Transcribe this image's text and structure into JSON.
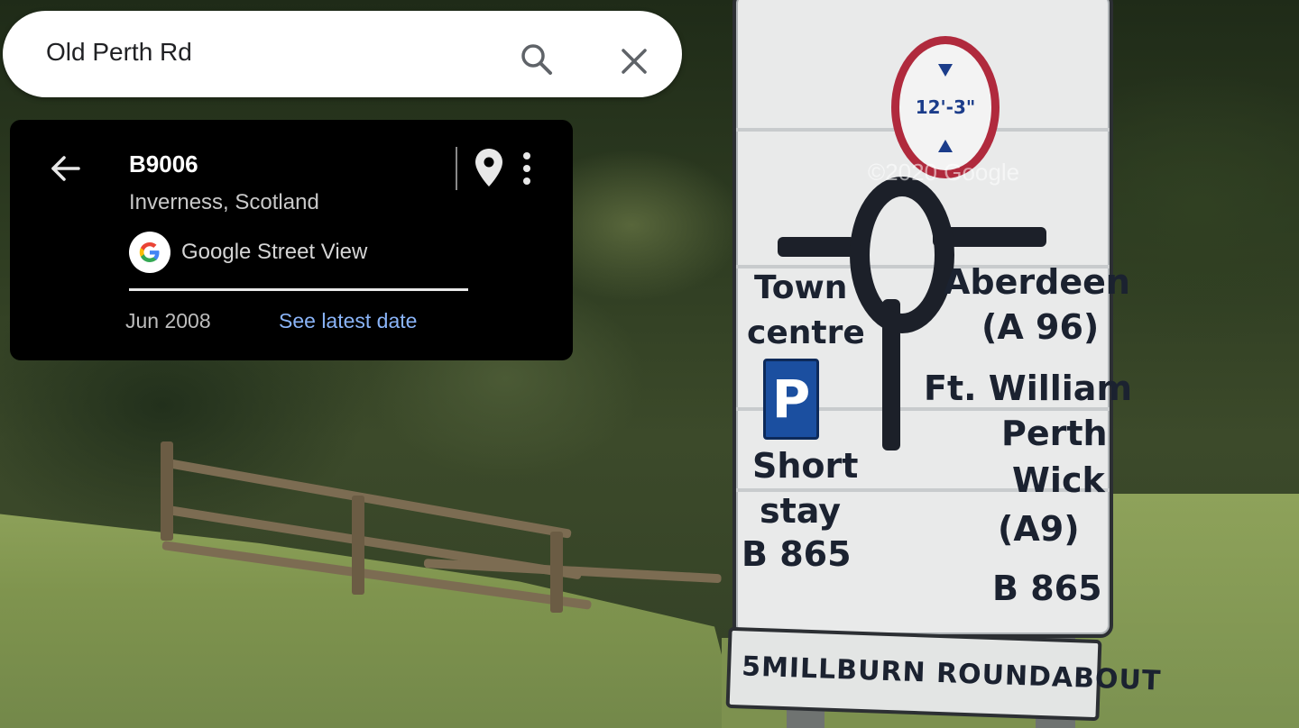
{
  "search": {
    "query": "Old Perth Rd"
  },
  "place_card": {
    "title": "B9006",
    "subtitle": "Inverness, Scotland",
    "source": "Google Street View",
    "capture_date": "Jun 2008",
    "latest_link": "See latest date"
  },
  "streetview": {
    "watermark": "©2020 Google",
    "sign": {
      "height_limit": "12'-3\"",
      "left_destination_1": "Town",
      "left_destination_2": "centre",
      "parking_letter": "P",
      "parking_1": "Short",
      "parking_2": "stay",
      "parking_road": "B 865",
      "right_1": "Aberdeen",
      "right_2": "(A 96)",
      "right_3": "Ft. William",
      "right_4": "Perth",
      "right_5": "Wick",
      "right_6": "(A9)",
      "right_7": "B 865",
      "roundabout_name": "5MILLBURN ROUNDABOUT"
    }
  },
  "colors": {
    "link": "#8ab4f8",
    "card_background": "#000000",
    "search_background": "#ffffff",
    "sign_red": "#b02a3d",
    "sign_blue": "#1b4fa0"
  }
}
